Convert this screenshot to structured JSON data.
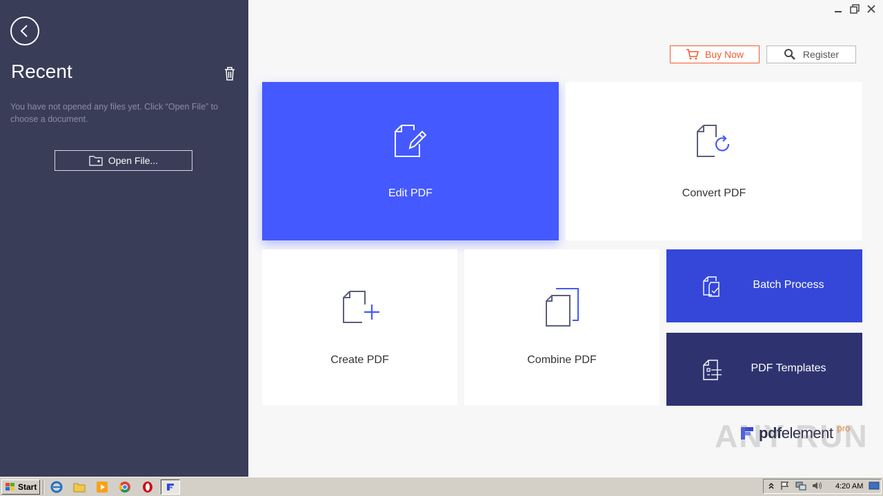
{
  "sidebar": {
    "title": "Recent",
    "empty_message": "You have not opened any files yet. Click “Open File” to choose a document.",
    "open_button_label": "Open File..."
  },
  "header": {
    "buy_label": "Buy Now",
    "register_label": "Register"
  },
  "tiles": {
    "edit": "Edit PDF",
    "convert": "Convert PDF",
    "create": "Create PDF",
    "combine": "Combine PDF",
    "batch": "Batch Process",
    "templates": "PDF Templates"
  },
  "brand": {
    "name_bold": "pdf",
    "name_light": "element",
    "edition": "pro",
    "watermark": "ANY RUN"
  },
  "taskbar": {
    "start_label": "Start",
    "clock": "4:20 AM"
  },
  "colors": {
    "sidebar_bg": "#3a3d57",
    "edit_tile": "#4459ff",
    "batch_tile": "#3447d8",
    "templates_tile": "#2e3370",
    "buy_accent": "#f25a2f"
  }
}
